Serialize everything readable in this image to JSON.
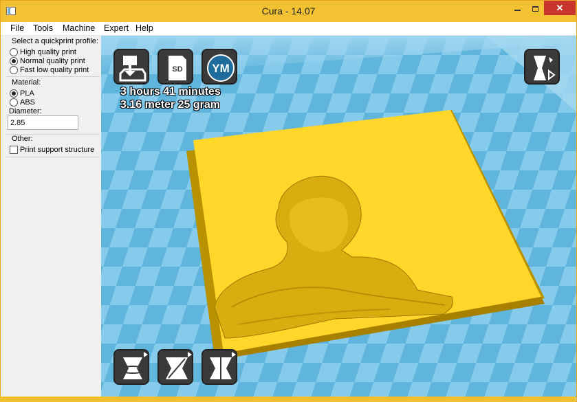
{
  "window": {
    "title": "Cura - 14.07"
  },
  "menu": [
    "File",
    "Tools",
    "Machine",
    "Expert",
    "Help"
  ],
  "quickprint": {
    "title": "Select a quickprint profile:",
    "options": [
      "High quality print",
      "Normal quality print",
      "Fast low quality print"
    ],
    "selected": "Normal quality print"
  },
  "material": {
    "title": "Material:",
    "options": [
      "PLA",
      "ABS"
    ],
    "selected": "PLA",
    "diameter_label": "Diameter:",
    "diameter_value": "2.85"
  },
  "other": {
    "title": "Other:",
    "support_label": "Print support structure",
    "support_checked": false
  },
  "viewport": {
    "print_time": "3 hours 41 minutes",
    "material_usage": "3.16 meter 25 gram",
    "toolbar_top": [
      {
        "name": "load-icon"
      },
      {
        "name": "save-to-sd-icon",
        "text": "SD"
      },
      {
        "name": "youmagine-icon",
        "text": "YM"
      }
    ],
    "view_mode_icon": "view-mode-icon",
    "toolbar_bottom": [
      "rotate-icon",
      "scale-icon",
      "mirror-icon"
    ]
  },
  "colors": {
    "accent": "#f2c232",
    "plate_light": "#88cdee",
    "plate_dark": "#5fb5dc",
    "model": "#ffd62a",
    "button": "#3a3a3a"
  }
}
